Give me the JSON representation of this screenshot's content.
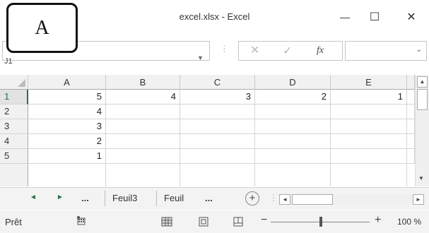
{
  "window": {
    "title": "excel.xlsx - Excel",
    "minimize_glyph": "—",
    "maximize_glyph": "☐",
    "close_glyph": "✕"
  },
  "callout_label": "A",
  "formula_bar": {
    "name_box": "J1",
    "cancel_glyph": "✕",
    "enter_glyph": "✓",
    "fx_label": "fx",
    "formula": ""
  },
  "grid": {
    "columns": [
      "A",
      "B",
      "C",
      "D",
      "E"
    ],
    "rows": [
      "1",
      "2",
      "3",
      "4",
      "5"
    ],
    "cells": [
      [
        "5",
        "4",
        "3",
        "2",
        "1"
      ],
      [
        "4",
        "",
        "",
        "",
        ""
      ],
      [
        "3",
        "",
        "",
        "",
        ""
      ],
      [
        "2",
        "",
        "",
        "",
        ""
      ],
      [
        "1",
        "",
        "",
        "",
        ""
      ]
    ],
    "active_row": "1"
  },
  "sheet_tabs": {
    "prev_glyph": "◄",
    "next_glyph": "►",
    "ellipsis_left": "...",
    "tabs": [
      "Feuil3",
      "Feuil"
    ],
    "ellipsis_right": "...",
    "add_glyph": "+"
  },
  "status_bar": {
    "status": "Prêt",
    "zoom_minus": "−",
    "zoom_plus": "+",
    "zoom_level": "100 %",
    "zoom_percent": 100
  },
  "colors": {
    "accent": "#217346",
    "header_bg": "#f1f1f1",
    "gridline": "#d4d4d4"
  },
  "icons": [
    "minimize-icon",
    "maximize-icon",
    "close-icon",
    "dropdown-arrow-icon",
    "cancel-icon",
    "enter-icon",
    "function-icon",
    "scroll-up-icon",
    "scroll-down-icon",
    "scroll-left-icon",
    "scroll-right-icon",
    "add-sheet-icon",
    "macro-record-icon",
    "normal-view-icon",
    "page-layout-view-icon",
    "page-break-view-icon"
  ]
}
